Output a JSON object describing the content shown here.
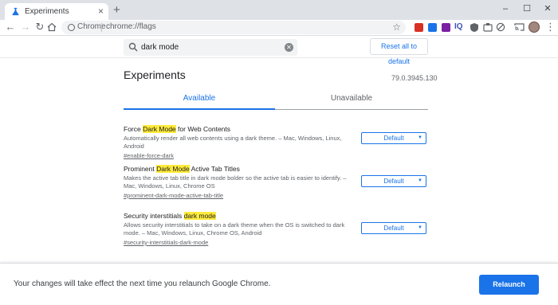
{
  "browser": {
    "tab_title": "Experiments",
    "omnibox": {
      "site_label": "Chrome",
      "url": "chrome://flags"
    }
  },
  "header": {
    "search_value": "dark mode",
    "reset_label": "Reset all to default"
  },
  "main": {
    "heading": "Experiments",
    "version": "79.0.3945.130",
    "tabs": [
      {
        "label": "Available",
        "active": true
      },
      {
        "label": "Unavailable",
        "active": false
      }
    ],
    "experiments": [
      {
        "title_pre": "Force ",
        "title_hl": "Dark Mode",
        "title_post": " for Web Contents",
        "description": "Automatically render all web contents using a dark theme. – Mac, Windows, Linux, Android",
        "link": "#enable-force-dark",
        "value": "Default"
      },
      {
        "title_pre": "Prominent ",
        "title_hl": "Dark Mode",
        "title_post": " Active Tab Titles",
        "description": "Makes the active tab title in dark mode bolder so the active tab is easier to identify. – Mac, Windows, Linux, Chrome OS",
        "link": "#prominent-dark-mode-active-tab-title",
        "value": "Default"
      },
      {
        "title_pre": "Security interstitials ",
        "title_hl": "dark mode",
        "title_post": "",
        "description": "Allows security interstitials to take on a dark theme when the OS is switched to dark mode. – Mac, Windows, Linux, Chrome OS, Android",
        "link": "#security-interstitials-dark-mode",
        "value": "Default"
      }
    ]
  },
  "footer": {
    "message": "Your changes will take effect the next time you relaunch Google Chrome.",
    "relaunch_label": "Relaunch"
  },
  "colors": {
    "accent": "#1a73e8",
    "highlight": "#ffeb3b",
    "tabstrip": "#dee1e6"
  },
  "extensions": [
    {
      "name": "red-extension-icon",
      "color": "#d93025"
    },
    {
      "name": "calendar-extension-icon",
      "color": "#1a73e8"
    },
    {
      "name": "purple-extension-icon",
      "color": "#7b1fa2"
    },
    {
      "name": "iq-extension-icon",
      "text": "IQ",
      "color": "#3f51b5"
    },
    {
      "name": "shield-extension-icon",
      "color": "#5f6368"
    },
    {
      "name": "puzzle-extension-icon",
      "color": "#5f6368"
    },
    {
      "name": "block-extension-icon",
      "color": "#5f6368"
    }
  ]
}
